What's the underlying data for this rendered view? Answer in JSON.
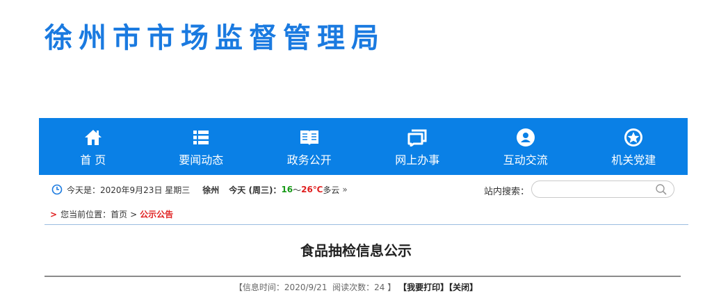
{
  "site": {
    "title": "徐州市市场监督管理局"
  },
  "nav": {
    "items": [
      {
        "label": "首 页",
        "icon": "home-icon"
      },
      {
        "label": "要闻动态",
        "icon": "list-icon"
      },
      {
        "label": "政务公开",
        "icon": "book-icon"
      },
      {
        "label": "网上办事",
        "icon": "window-icon"
      },
      {
        "label": "互动交流",
        "icon": "user-circle-icon"
      },
      {
        "label": "机关党建",
        "icon": "star-circle-icon"
      }
    ],
    "colors": {
      "background": "#0a80e6",
      "text": "#ffffff"
    }
  },
  "infobar": {
    "date_text": "今天是：2020年9月23日 星期三",
    "weather": {
      "city": "徐州",
      "today": "今天 (周三)：",
      "temp_low": "16",
      "temp_sep": "～",
      "temp_high": "26℃",
      "condition": "多云",
      "more": "»"
    },
    "search_label": "站内搜索：",
    "search_placeholder": ""
  },
  "breadcrumb": {
    "marker": ">",
    "prefix": "您当前位置：",
    "home": "首页",
    "separator": ">",
    "current": "公示公告"
  },
  "article": {
    "title": "食品抽检信息公示",
    "meta": {
      "open_bracket": "【",
      "time_label": "信息时间：",
      "time_value": "2020/9/21",
      "views_label": "阅读次数：",
      "views_value": "24",
      "close_bracket": "】",
      "print_label": "【我要打印】",
      "close_label": "【关闭】"
    }
  },
  "colors": {
    "brand": "#1a7ae0",
    "accent_red": "#e02020",
    "temp_low": "#189a18"
  }
}
